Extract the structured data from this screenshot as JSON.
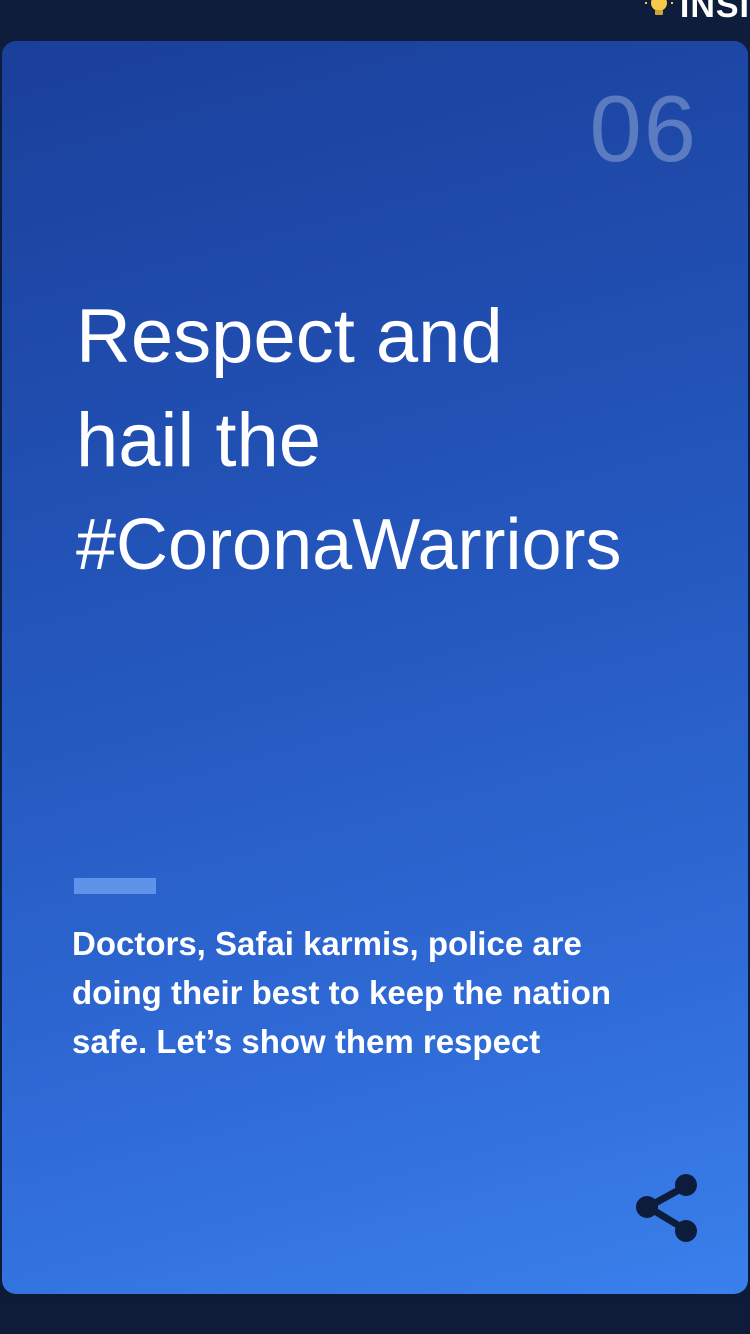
{
  "brand": {
    "text": "INSI",
    "icon": "lightbulb-icon"
  },
  "card": {
    "number": "06",
    "headline": {
      "line1": "Respect and",
      "line2": "hail the",
      "line3": "#CoronaWarriors"
    },
    "body": "Doctors, Safai karmis, police are doing their best to keep the nation safe. Let’s show them respect",
    "share_icon": "share-icon"
  },
  "colors": {
    "card_gradient_top": "#1a3f9a",
    "card_gradient_bottom": "#3a80ec",
    "accent_bar": "#5f93ea",
    "background": "#0d1c3a",
    "share_icon": "#0d1c3a"
  }
}
